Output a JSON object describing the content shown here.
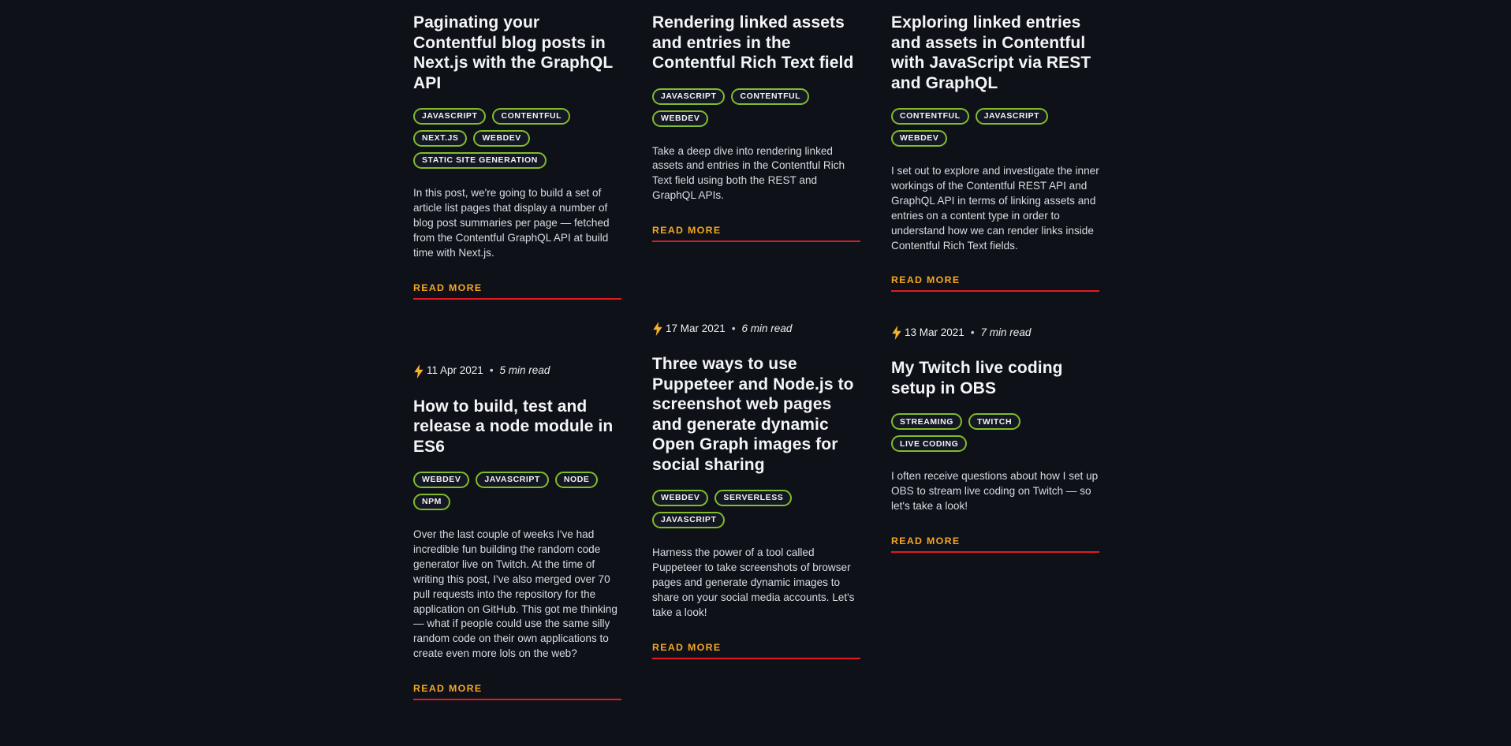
{
  "theme": {
    "background": "#0e1118",
    "title_color": "#f4f5f7",
    "body_color": "#d9dbe1",
    "tag_border": "#82bb2c",
    "readmore_color": "#f5a623",
    "rule_color": "#e01b24",
    "bolt_color": "#f5b32b"
  },
  "read_more_label": "READ MORE",
  "meta_separator": "•",
  "bolt_icon": "lightning-bolt-icon",
  "columns": [
    {
      "cards": [
        {
          "has_meta": false,
          "title": "Paginating your Contentful blog posts in Next.js with the GraphQL API",
          "tags": [
            "JAVASCRIPT",
            "CONTENTFUL",
            "NEXT.JS",
            "WEBDEV",
            "STATIC SITE GENERATION"
          ],
          "excerpt": "In this post, we're going to build a set of article list pages that display a number of blog post summaries per page — fetched from the Contentful GraphQL API at build time with Next.js.",
          "read_more": "READ MORE"
        },
        {
          "has_meta": true,
          "date": "11 Apr 2021",
          "read_time": "5 min read",
          "title": "How to build, test and release a node module in ES6",
          "tags": [
            "WEBDEV",
            "JAVASCRIPT",
            "NODE",
            "NPM"
          ],
          "excerpt": "Over the last couple of weeks I've had incredible fun building the random code generator live on Twitch. At the time of writing this post, I've also merged over 70 pull requests into the repository for the application on GitHub. This got me thinking — what if people could use the same silly random code on their own applications to create even more lols on the web?",
          "read_more": "READ MORE"
        }
      ]
    },
    {
      "cards": [
        {
          "has_meta": false,
          "title": "Rendering linked assets and entries in the Contentful Rich Text field",
          "tags": [
            "JAVASCRIPT",
            "CONTENTFUL",
            "WEBDEV"
          ],
          "excerpt": "Take a deep dive into rendering linked assets and entries in the Contentful Rich Text field using both the REST and GraphQL APIs.",
          "read_more": "READ MORE"
        },
        {
          "has_meta": true,
          "date": "17 Mar 2021",
          "read_time": "6 min read",
          "title": "Three ways to use Puppeteer and Node.js to screenshot web pages and generate dynamic Open Graph images for social sharing",
          "tags": [
            "WEBDEV",
            "SERVERLESS",
            "JAVASCRIPT"
          ],
          "excerpt": "Harness the power of a tool called Puppeteer to take screenshots of browser pages and generate dynamic images to share on your social media accounts. Let's take a look!",
          "read_more": "READ MORE"
        }
      ]
    },
    {
      "cards": [
        {
          "has_meta": false,
          "title": "Exploring linked entries and assets in Contentful with JavaScript via REST and GraphQL",
          "tags": [
            "CONTENTFUL",
            "JAVASCRIPT",
            "WEBDEV"
          ],
          "excerpt": "I set out to explore and investigate the inner workings of the Contentful REST API and GraphQL API in terms of linking assets and entries on a content type in order to understand how we can render links inside Contentful Rich Text fields.",
          "read_more": "READ MORE"
        },
        {
          "has_meta": true,
          "date": "13 Mar 2021",
          "read_time": "7 min read",
          "title": "My Twitch live coding setup in OBS",
          "tags": [
            "STREAMING",
            "TWITCH",
            "LIVE CODING"
          ],
          "excerpt": "I often receive questions about how I set up OBS to stream live coding on Twitch — so let's take a look!",
          "read_more": "READ MORE"
        }
      ]
    }
  ]
}
